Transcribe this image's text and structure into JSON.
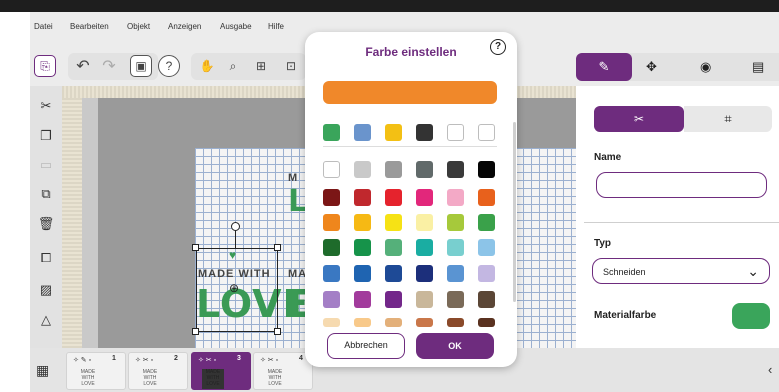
{
  "menu": [
    "Datei",
    "Bearbeiten",
    "Objekt",
    "Anzeigen",
    "Ausgabe",
    "Hilfe"
  ],
  "canvas": {
    "made_with": "MADE WITH",
    "love": "LOVE",
    "partial_made": "MA",
    "partial_love": "L",
    "partial_top": "M"
  },
  "right_panel": {
    "name_label": "Name",
    "name_value": "",
    "typ_label": "Typ",
    "typ_value": "Schneiden",
    "material_label": "Materialfarbe",
    "material_color": "#3aa55b"
  },
  "thumbnails": [
    {
      "num": "1",
      "text": "MADE WITH LOVE"
    },
    {
      "num": "2",
      "text": "MADE WITH LOVE"
    },
    {
      "num": "3",
      "text": "MADE WITH LOVE"
    },
    {
      "num": "4",
      "text": "MADE WITH LOVE"
    }
  ],
  "dialog": {
    "title": "Farbe einstellen",
    "help": "?",
    "current_color": "#f0882a",
    "recent_colors": [
      "#3aa55b",
      "#6a94cc",
      "#f3c014",
      "#333333",
      "#ffffff",
      "#ffffff"
    ],
    "palette": [
      [
        "#ffffff",
        "#c9c9c9",
        "#9a9a9a",
        "#616a6a",
        "#3a3a3a",
        "#050505"
      ],
      [
        "#7b1616",
        "#c0282d",
        "#e5232d",
        "#e2277b",
        "#f3a9c6",
        "#e8611c"
      ],
      [
        "#ef861c",
        "#f6b914",
        "#f6e215",
        "#faf0a4",
        "#a6c93b",
        "#3aa14a"
      ],
      [
        "#1e6b2b",
        "#16934a",
        "#55b07a",
        "#1aada2",
        "#78cfcf",
        "#8cc4e8"
      ],
      [
        "#3a78c2",
        "#1f64b1",
        "#1e4a96",
        "#1c2f7b",
        "#5a94d2",
        "#c3b7e2"
      ],
      [
        "#a47fc6",
        "#a23b9c",
        "#73278a",
        "#c9b79a",
        "#7a6a58",
        "#5b4636"
      ],
      [
        "#f6dab0",
        "#f8c98a",
        "#e3b07a",
        "#c9774a",
        "#8a4a2a",
        "#5a3220"
      ]
    ],
    "cancel_label": "Abbrechen",
    "ok_label": "OK"
  }
}
